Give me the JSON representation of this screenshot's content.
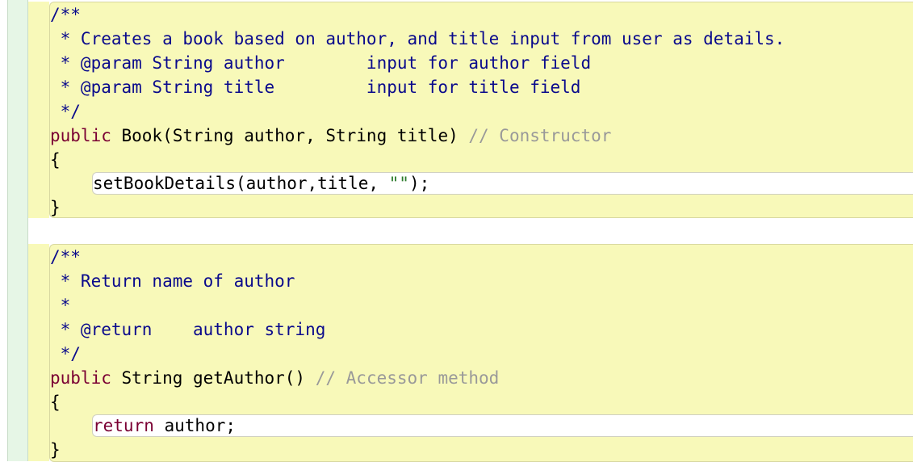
{
  "method1": {
    "doc": [
      "/**",
      " * Creates a book based on author, and title input from user as details.",
      " * @param String author        input for author field",
      " * @param String title         input for title field",
      " */"
    ],
    "sig_keyword": "public",
    "sig_rest": " Book(String author, String title) ",
    "sig_comment": "// Constructor",
    "open_brace": "{",
    "body_code": "setBookDetails(author,title, ",
    "body_string": "\"\"",
    "body_tail": ");",
    "close_brace": "}"
  },
  "method2": {
    "doc": [
      "/**",
      " * Return name of author",
      " *",
      " * @return    author string",
      " */"
    ],
    "sig_keyword": "public",
    "sig_rest": " String getAuthor() ",
    "sig_comment": "// Accessor method",
    "open_brace": "{",
    "body_keyword": "return",
    "body_code": " author;",
    "close_brace": "}"
  }
}
